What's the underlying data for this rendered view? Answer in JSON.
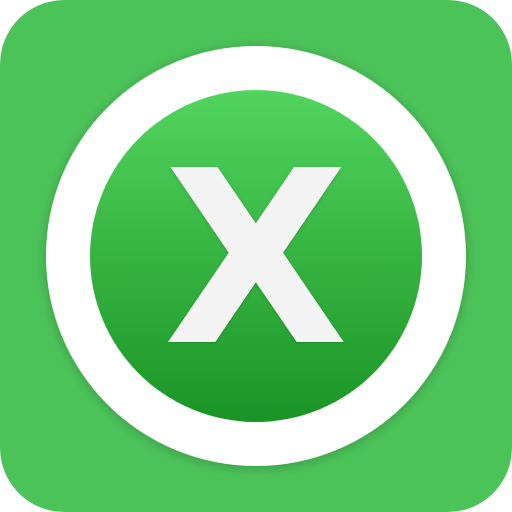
{
  "app_icon": {
    "glyph": "X",
    "icon_name": "app-icon-x-letter",
    "colors": {
      "tile": "#4cc359",
      "ring": "#ffffff",
      "disc_top": "#52d45e",
      "disc_bottom": "#1a9426",
      "glyph": "#f4f4f4"
    }
  }
}
